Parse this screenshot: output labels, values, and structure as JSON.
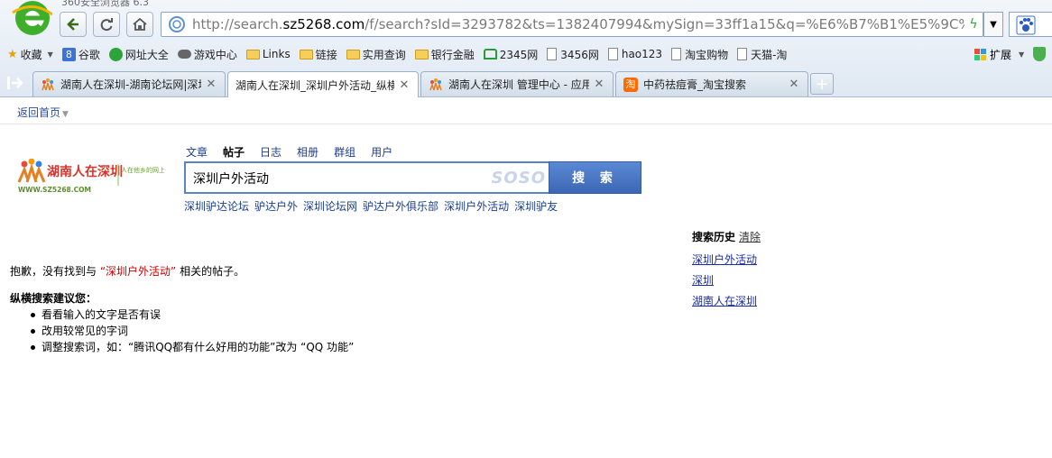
{
  "browser": {
    "window_title": "360安全浏览器 6.3",
    "address": {
      "url_prefix": "http://search.",
      "url_domain": "sz5268.com",
      "url_suffix": "/f/search?sId=3293782&ts=1382407994&mySign=33ff1a15&q=%E6%B7%B1%E5%9C%B3%"
    },
    "bookmarks": [
      {
        "label": "收藏",
        "icon": "star-icon"
      },
      {
        "label": "谷歌",
        "icon": "google-icon"
      },
      {
        "label": "网址大全",
        "icon": "site-nav-icon"
      },
      {
        "label": "游戏中心",
        "icon": "gamepad-icon"
      },
      {
        "label": "Links",
        "icon": "folder-icon"
      },
      {
        "label": "链接",
        "icon": "folder-icon"
      },
      {
        "label": "实用查询",
        "icon": "folder-icon"
      },
      {
        "label": "银行金融",
        "icon": "folder-icon"
      },
      {
        "label": "2345网",
        "icon": "house-icon"
      },
      {
        "label": "3456网",
        "icon": "page-icon"
      },
      {
        "label": "hao123",
        "icon": "page-icon"
      },
      {
        "label": "淘宝购物",
        "icon": "page-icon"
      },
      {
        "label": "天猫-淘",
        "icon": "page-icon"
      }
    ],
    "extensions_label": "扩展",
    "tabs": [
      {
        "title": "湖南人在深圳-湖南论坛网|深圳",
        "active": false
      },
      {
        "title": "湖南人在深圳_深圳户外活动_纵横",
        "active": true
      },
      {
        "title": "湖南人在深圳 管理中心 - 应用",
        "active": false
      },
      {
        "title": "中药祛痘膏_淘宝搜索",
        "active": false
      }
    ]
  },
  "page": {
    "back_home": "返回首页",
    "logo_text": "湖南人在深圳",
    "logo_slogan": "人在他乡的网上家园网",
    "logo_url": "WWW.SZ5268.COM",
    "search_tabs": [
      "文章",
      "帖子",
      "日志",
      "相册",
      "群组",
      "用户"
    ],
    "search_tab_current": "帖子",
    "search_value": "深圳户外活动",
    "search_watermark": "SOSO",
    "search_button": "搜 索",
    "hot_words": [
      "深圳驴达论坛",
      "驴达户外",
      "深圳论坛网",
      "驴达户外俱乐部",
      "深圳户外活动",
      "深圳驴友"
    ],
    "no_result": {
      "before": "抱歉，没有找到与 ",
      "keyword": "“深圳户外活动”",
      "after": " 相关的帖子。"
    },
    "suggest_title": "纵横搜索建议您：",
    "suggestions": [
      "看看输入的文字是否有误",
      "改用较常见的字词",
      "调整搜索词，如：“腾讯QQ都有什么好用的功能”改为 “QQ 功能”"
    ],
    "history": {
      "title": "搜索历史",
      "clear": "清除",
      "items": [
        "深圳户外活动",
        "深圳",
        "湖南人在深圳"
      ]
    }
  }
}
